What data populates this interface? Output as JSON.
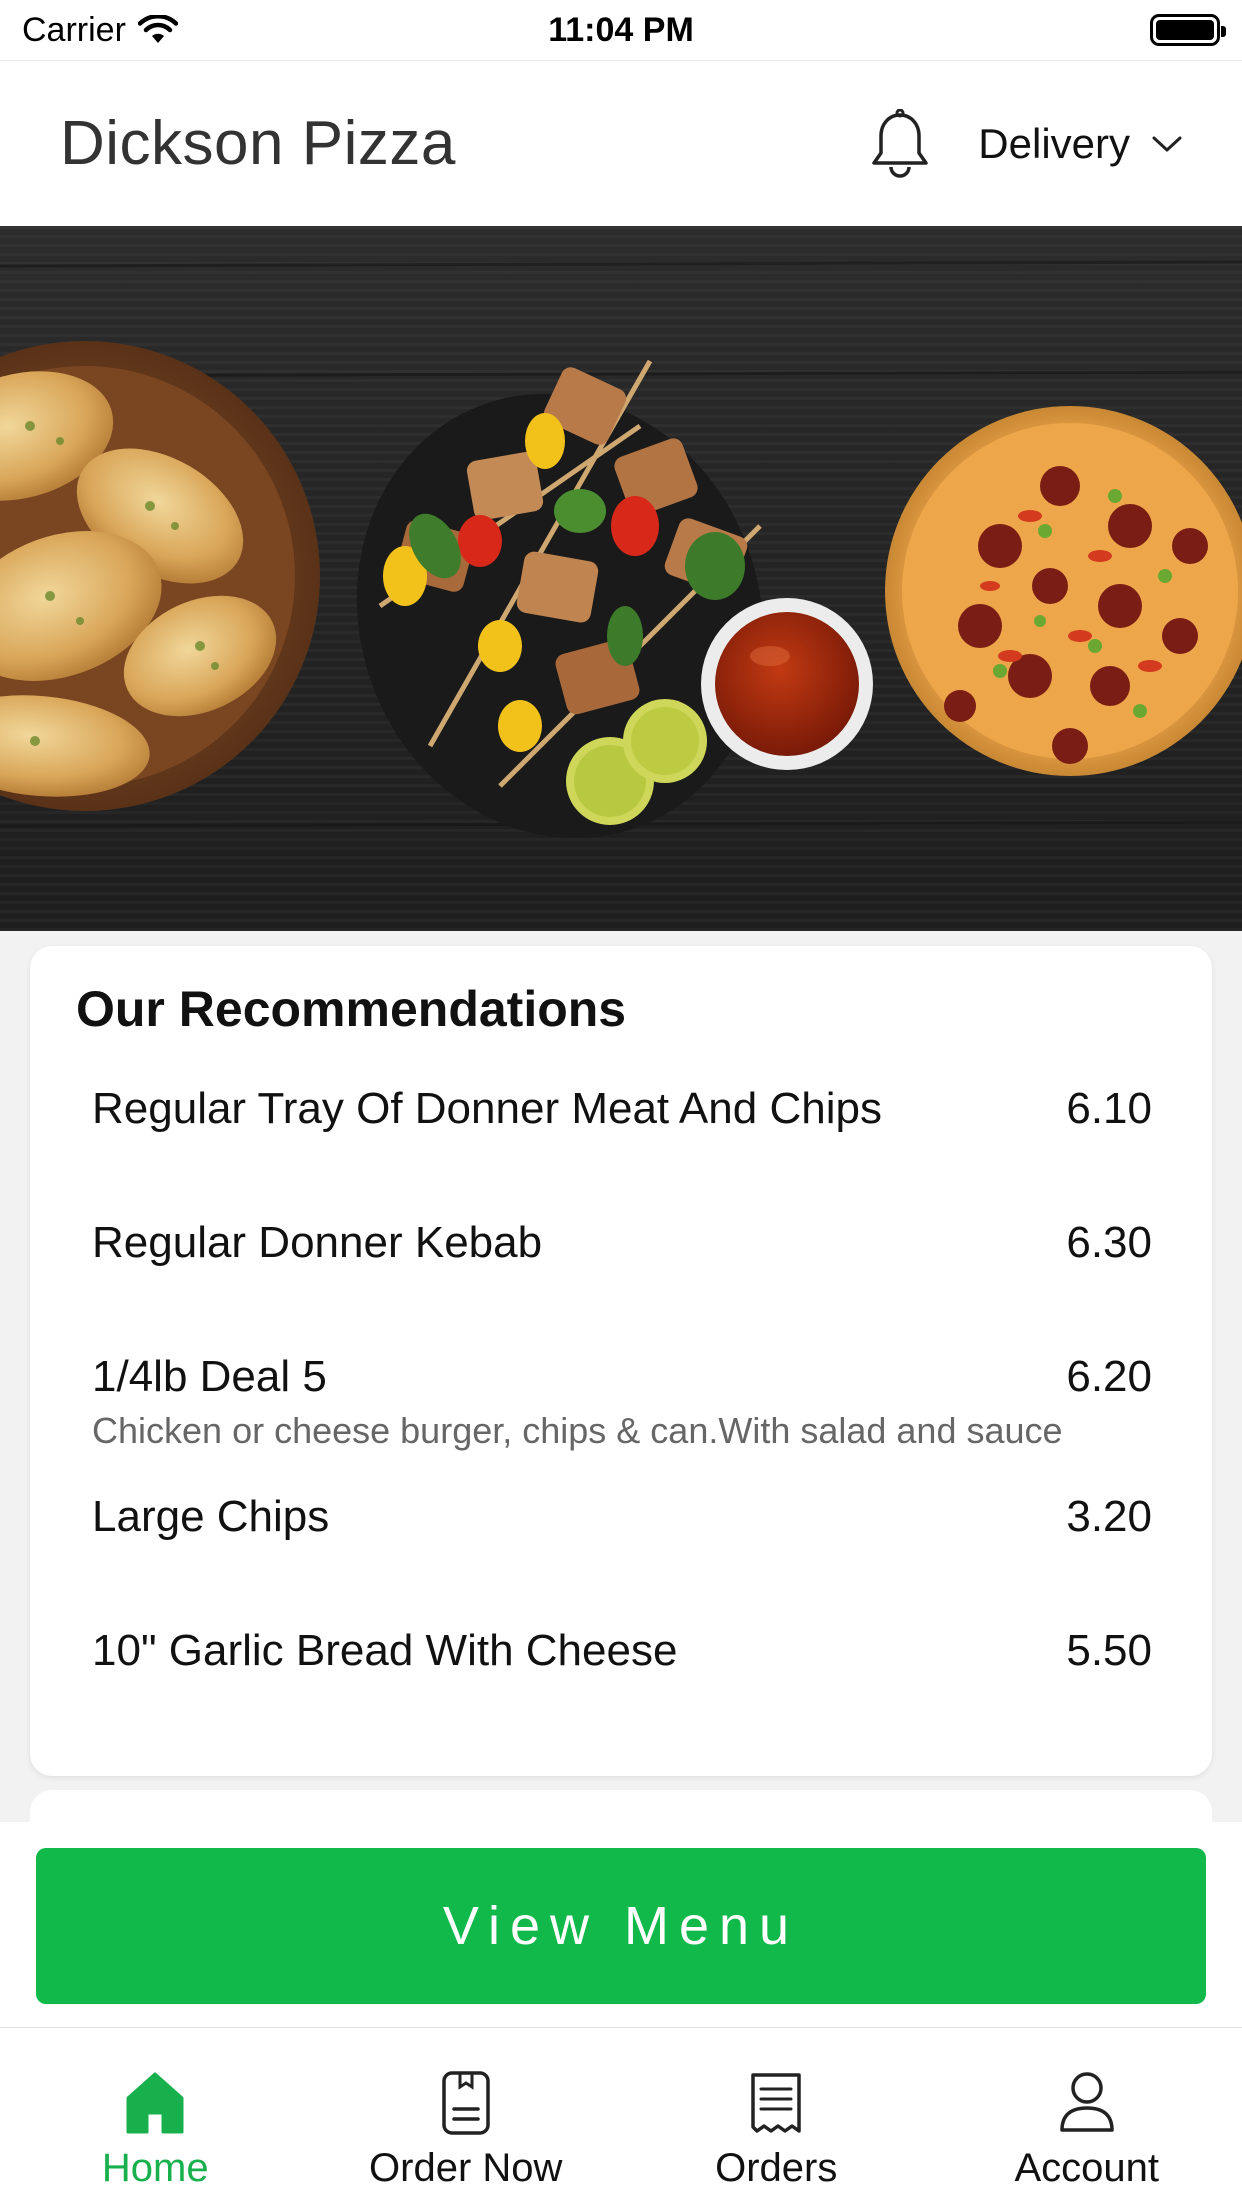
{
  "status_bar": {
    "carrier": "Carrier",
    "time": "11:04 PM"
  },
  "header": {
    "title": "Dickson Pizza",
    "delivery_mode": "Delivery",
    "icons": {
      "notifications": "bell-icon",
      "dropdown": "chevron-down-icon"
    }
  },
  "hero": {
    "image": "food-banner: garlic bread, chicken skewers with dipping sauce, pepperoni pizza on dark wood"
  },
  "recommendations": {
    "title": "Our Recommendations",
    "items": [
      {
        "name": "Regular Tray Of Donner Meat And Chips",
        "price": "6.10",
        "description": ""
      },
      {
        "name": "Regular Donner Kebab",
        "price": "6.30",
        "description": ""
      },
      {
        "name": "1/4lb Deal 5",
        "price": "6.20",
        "description": "Chicken or cheese burger, chips & can.With salad and sauce"
      },
      {
        "name": "Large Chips",
        "price": "3.20",
        "description": ""
      },
      {
        "name": "10\" Garlic Bread With Cheese",
        "price": "5.50",
        "description": ""
      }
    ]
  },
  "actions": {
    "view_menu": "View Menu"
  },
  "tab_bar": {
    "tabs": [
      {
        "label": "Home",
        "icon": "home-icon",
        "active": true
      },
      {
        "label": "Order Now",
        "icon": "order-document-icon",
        "active": false
      },
      {
        "label": "Orders",
        "icon": "receipt-icon",
        "active": false
      },
      {
        "label": "Account",
        "icon": "user-icon",
        "active": false
      }
    ]
  },
  "colors": {
    "accent_green": "#10b94a",
    "active_tab": "#18b04d",
    "hero_background": "#262626"
  }
}
